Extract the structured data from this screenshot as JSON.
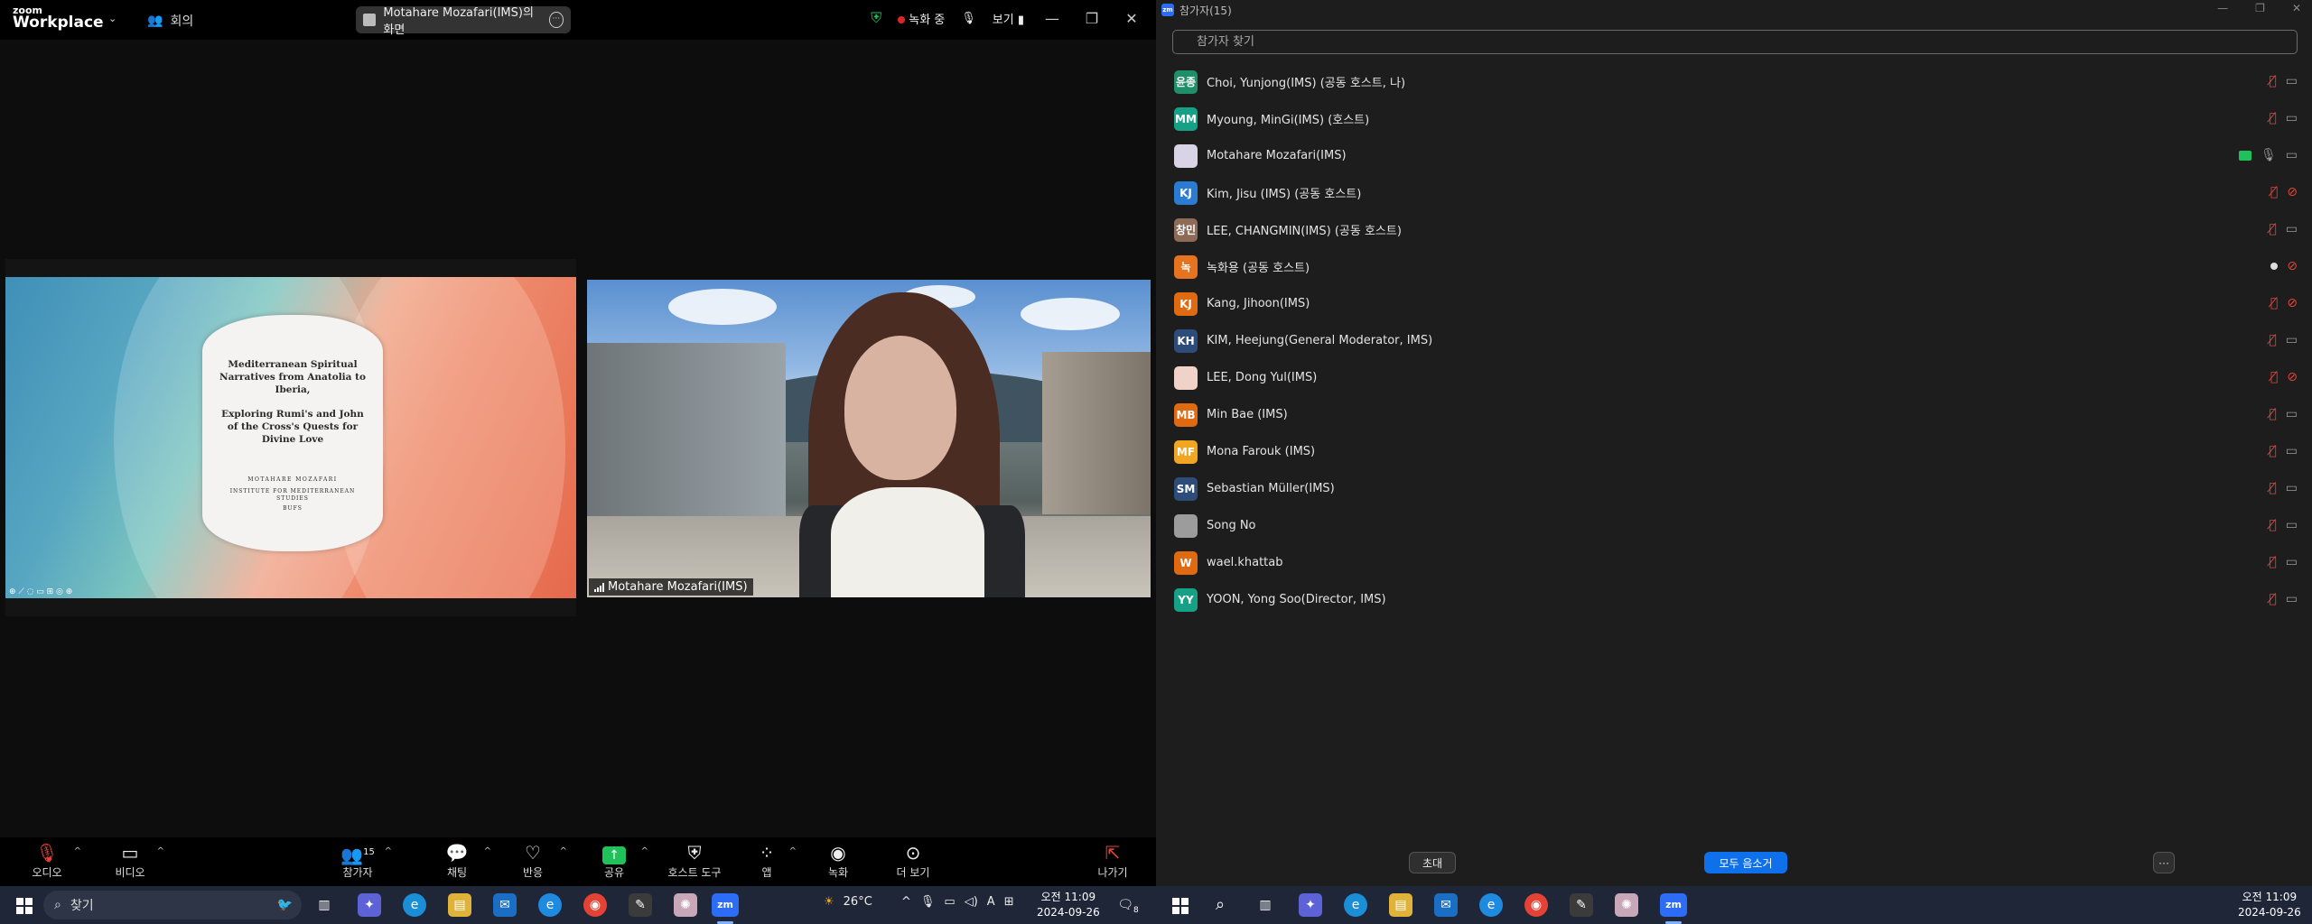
{
  "app": {
    "logo_line1": "zoom",
    "logo_line2": "Workplace",
    "meeting_label": "회의"
  },
  "share_banner": {
    "label": "Motahare Mozafari(IMS)의 화면"
  },
  "title_controls": {
    "recording": "녹화 중",
    "view": "보기"
  },
  "slide": {
    "title": "Mediterranean Spiritual Narratives from Anatolia to Iberia,",
    "subtitle": "Exploring Rumi's and John of the Cross's Quests for Divine Love",
    "author": "MOTAHARE MOZAFARI",
    "institute": "INSTITUTE FOR MEDITERRANEAN STUDIES",
    "school": "BUFS"
  },
  "video": {
    "name": "Motahare Mozafari(IMS)"
  },
  "toolbar": {
    "audio": "오디오",
    "video": "비디오",
    "participants": "참가자",
    "participants_count": "15",
    "chat": "채팅",
    "react": "반응",
    "share": "공유",
    "host_tools": "호스트 도구",
    "apps": "앱",
    "record": "녹화",
    "more": "더 보기",
    "leave": "나가기"
  },
  "panel": {
    "title": "참가자(15)",
    "search_placeholder": "참가자 찾기",
    "invite": "초대",
    "mute_all": "모두 음소거",
    "more": "···"
  },
  "participants": [
    {
      "initials": "윤종",
      "color": "#1f8f6a",
      "name": "Choi, Yunjong(IMS) (공동 호스트, 나)",
      "mic": "off",
      "cam": "on"
    },
    {
      "initials": "MM",
      "color": "#16a085",
      "name": "Myoung, MinGi(IMS) (호스트)",
      "mic": "off",
      "cam": "on"
    },
    {
      "initials": "",
      "color": "#d8d4e6",
      "name": "Motahare Mozafari(IMS)",
      "mic": "on",
      "cam": "on",
      "sharing": true
    },
    {
      "initials": "KJ",
      "color": "#2a7bd1",
      "name": "Kim, Jisu (IMS) (공동 호스트)",
      "mic": "off",
      "cam": "off"
    },
    {
      "initials": "창민",
      "color": "#8e6b58",
      "name": "LEE, CHANGMIN(IMS) (공동 호스트)",
      "mic": "off",
      "cam": "on"
    },
    {
      "initials": "녹",
      "color": "#e6731f",
      "name": "녹화용 (공동 호스트)",
      "mic": "dot",
      "cam": "off"
    },
    {
      "initials": "KJ",
      "color": "#e06a12",
      "name": "Kang, Jihoon(IMS)",
      "mic": "off",
      "cam": "off"
    },
    {
      "initials": "KH",
      "color": "#2d4c7a",
      "name": "KIM, Heejung(General Moderator, IMS)",
      "mic": "off",
      "cam": "on"
    },
    {
      "initials": "",
      "color": "#f1d2c8",
      "name": "LEE, Dong Yul(IMS)",
      "mic": "off",
      "cam": "off"
    },
    {
      "initials": "MB",
      "color": "#e06a12",
      "name": "Min Bae (IMS)",
      "mic": "off",
      "cam": "on"
    },
    {
      "initials": "MF",
      "color": "#f0a623",
      "name": "Mona Farouk (IMS)",
      "mic": "off",
      "cam": "on"
    },
    {
      "initials": "SM",
      "color": "#2d4c7a",
      "name": "Sebastian Müller(IMS)",
      "mic": "off",
      "cam": "on"
    },
    {
      "initials": "",
      "color": "#9c9c9c",
      "name": "Song No",
      "mic": "off",
      "cam": "on"
    },
    {
      "initials": "W",
      "color": "#e06a12",
      "name": "wael.khattab",
      "mic": "off",
      "cam": "on"
    },
    {
      "initials": "YY",
      "color": "#16a085",
      "name": "YOON, Yong Soo(Director, IMS)",
      "mic": "off",
      "cam": "on"
    }
  ],
  "taskbar_left": {
    "search": "찾기",
    "temp": "26°C",
    "ime": "A",
    "time": "오전 11:09",
    "date": "2024-09-26",
    "notif": "8"
  },
  "taskbar_right": {
    "time": "오전 11:09",
    "date": "2024-09-26"
  },
  "colors": {
    "accent": "#0e71eb",
    "share_green": "#20c05a",
    "mute_red": "#e0453b"
  }
}
